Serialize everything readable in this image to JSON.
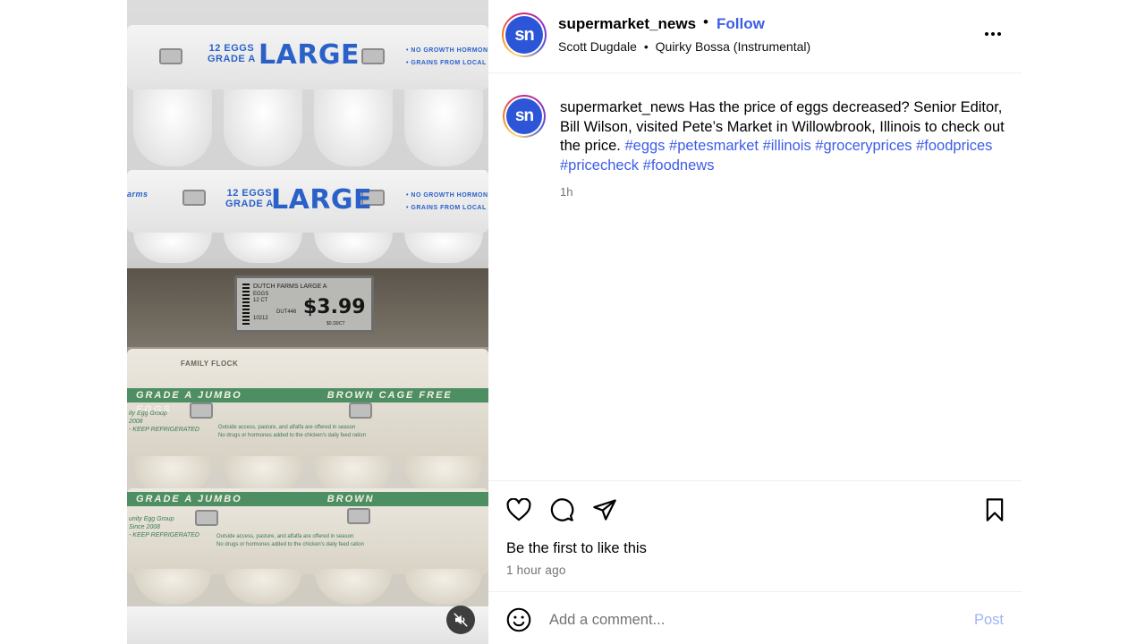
{
  "media": {
    "carton1": {
      "count_grade": "12 EGGS\nGRADE A",
      "size": "LARGE",
      "fine_print": "• NO GROWTH HORMONES\n• GRAINS FROM LOCAL FA"
    },
    "carton2": {
      "brand": "arms",
      "count_grade": "12 EGGS\nGRADE A",
      "size": "LARGE",
      "fine_print": "• NO GROWTH HORMONES\n• GRAINS FROM LOCAL FAR"
    },
    "price_tag": {
      "product": "DUTCH FARMS LARGE A",
      "line2": "EGGS",
      "line3": "12 CT",
      "code": "DUT446",
      "line4": "10212",
      "price": "$3.99",
      "unit": "$0.33/CT"
    },
    "carton3": {
      "brand": "FAMILY FLOCK",
      "stripe_left": "GRADE A JUMBO",
      "stripe_right": "BROWN CAGE FREE EGGS",
      "side": "ity Egg Group\n2008\n- KEEP REFRIGERATED",
      "fine": "Outside access, pasture, and alfalfa are offered in season\nNo drugs or hormones added to the chicken's daily feed ration"
    },
    "carton4": {
      "stripe_left": "GRADE A JUMBO",
      "stripe_right": "BROWN",
      "side": "unity Egg Group\nSince 2008\n- KEEP REFRIGERATED",
      "fine": "Outside access, pasture, and alfalfa are offered in season\nNo drugs or hormones added to the chicken's daily feed ration"
    },
    "mute_icon": "speaker-muted-icon"
  },
  "header": {
    "avatar_text": "sn",
    "username": "supermarket_news",
    "separator": "•",
    "follow_label": "Follow",
    "audio_artist": "Scott Dugdale",
    "audio_separator": "•",
    "audio_track": "Quirky Bossa (Instrumental)",
    "more_icon": "more-horizontal-icon"
  },
  "caption": {
    "avatar_text": "sn",
    "username": "supermarket_news",
    "text": " Has the price of eggs decreased? Senior Editor, Bill Wilson, visited Pete’s Market in Willowbrook, Illinois to check out the price. ",
    "hashtags": [
      "#eggs",
      "#petesmarket",
      "#illinois",
      "#groceryprices",
      "#foodprices",
      "#pricecheck",
      "#foodnews"
    ],
    "time": "1h"
  },
  "actions": {
    "like_icon": "heart-icon",
    "comment_icon": "comment-icon",
    "share_icon": "send-icon",
    "save_icon": "bookmark-icon",
    "likes_text": "Be the first to like this",
    "timestamp": "1 hour ago"
  },
  "comment_bar": {
    "emoji_icon": "smiley-icon",
    "placeholder": "Add a comment...",
    "value": "",
    "post_label": "Post"
  },
  "colors": {
    "accent": "#3d5de6",
    "post_disabled": "#9fb3f5",
    "avatar_bg": "#2c55d8",
    "muted_text": "#737373"
  }
}
